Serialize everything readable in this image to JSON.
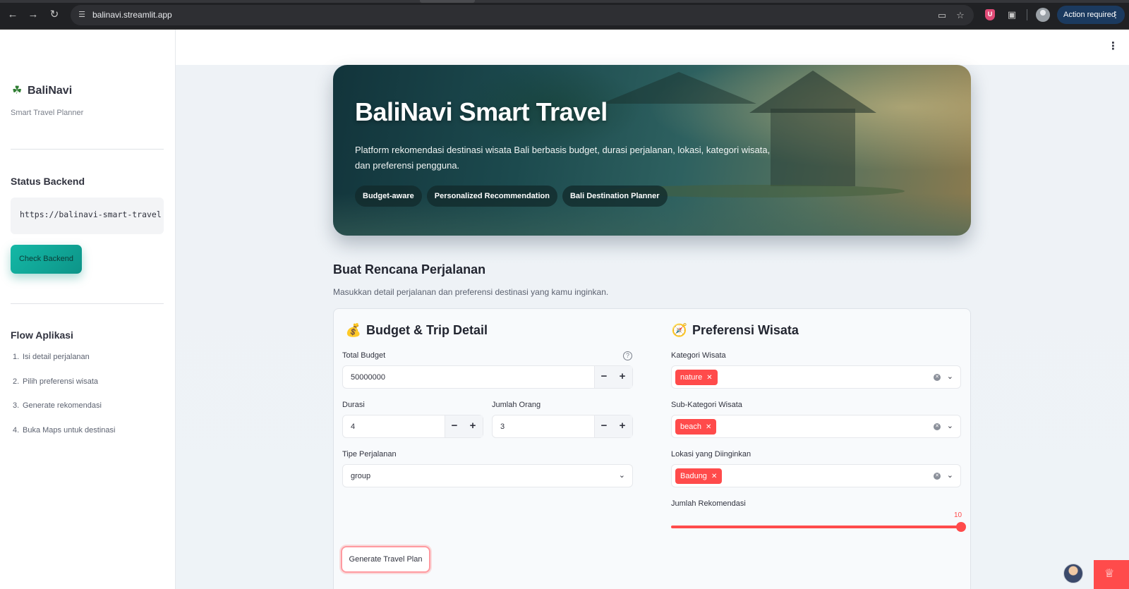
{
  "browser": {
    "url": "balinavi.streamlit.app",
    "action_label": "Action required"
  },
  "sidebar": {
    "brand": "BaliNavi",
    "brand_icon": "palm-tree-icon",
    "subtitle": "Smart Travel Planner",
    "status_heading": "Status Backend",
    "backend_url": "https://balinavi-smart-travel",
    "check_button": "Check Backend",
    "flow_heading": "Flow Aplikasi",
    "flow_items": [
      {
        "num": "1.",
        "label": "Isi detail perjalanan"
      },
      {
        "num": "2.",
        "label": "Pilih preferensi wisata"
      },
      {
        "num": "3.",
        "label": "Generate rekomendasi"
      },
      {
        "num": "4.",
        "label": "Buka Maps untuk destinasi"
      }
    ]
  },
  "hero": {
    "title": "BaliNavi Smart Travel",
    "description": "Platform rekomendasi destinasi wisata Bali berbasis budget, durasi perjalanan, lokasi, kategori wisata, dan preferensi pengguna.",
    "chips": [
      "Budget-aware",
      "Personalized Recommendation",
      "Bali Destination Planner"
    ]
  },
  "section": {
    "title": "Buat Rencana Perjalanan",
    "description": "Masukkan detail perjalanan dan preferensi destinasi yang kamu inginkan."
  },
  "budget": {
    "heading": "Budget & Trip Detail",
    "heading_icon": "money-bag-icon",
    "total_budget_label": "Total Budget",
    "total_budget_value": "50000000",
    "durasi_label": "Durasi",
    "durasi_value": "4",
    "jumlah_orang_label": "Jumlah Orang",
    "jumlah_orang_value": "3",
    "tipe_label": "Tipe Perjalanan",
    "tipe_value": "group",
    "minus": "−",
    "plus": "+"
  },
  "preferensi": {
    "heading": "Preferensi Wisata",
    "heading_icon": "compass-icon",
    "kategori_label": "Kategori Wisata",
    "kategori_tag": "nature",
    "sub_kategori_label": "Sub-Kategori Wisata",
    "sub_kategori_tag": "beach",
    "lokasi_label": "Lokasi yang Diinginkan",
    "lokasi_tag": "Badung",
    "jumlah_rekomendasi_label": "Jumlah Rekomendasi",
    "jumlah_rekomendasi_value": "10",
    "jumlah_rekomendasi_fraction": 1.0
  },
  "generate_button": "Generate Travel Plan",
  "colors": {
    "accent": "#ff4b4b",
    "teal": "#14b8a6"
  }
}
